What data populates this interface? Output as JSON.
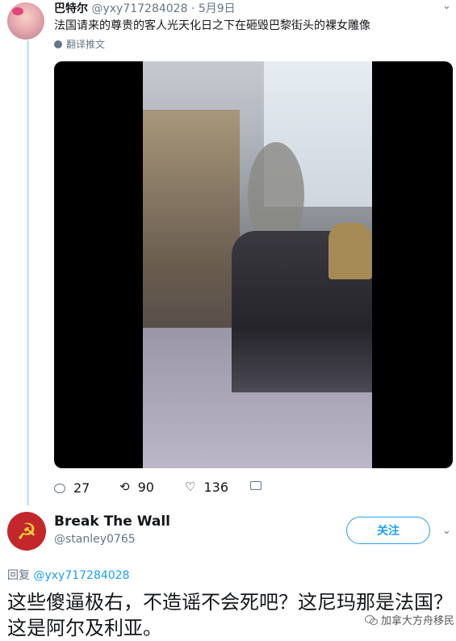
{
  "tweet1": {
    "display_name": "巴特尔",
    "handle": "@yxy717284028",
    "date": "· 5月9日",
    "text": "法国请来的尊贵的客人光天化日之下在砸毁巴黎街头的裸女雕像",
    "translate_label": "翻译推文",
    "actions": {
      "reply_count": "27",
      "retweet_count": "90",
      "like_count": "136"
    }
  },
  "tweet2": {
    "display_name": "Break The Wall",
    "handle": "@stanley0765",
    "follow_label": "关注",
    "replying_prefix": "回复",
    "replying_to": "@yxy717284028",
    "text": "这些傻逼极右，不造谣不会死吧？这尼玛那是法国？这是阿尔及利亚。"
  },
  "watermark": {
    "text": "加拿大方舟移民"
  },
  "icons": {
    "chevron": "chevron-down-icon",
    "reply": "reply-icon",
    "retweet": "retweet-icon",
    "like": "heart-icon",
    "dm": "mail-icon",
    "globe": "globe-icon"
  },
  "colors": {
    "accent": "#1da1f2",
    "muted": "#657786",
    "thread_line": "#c4e8f7"
  }
}
